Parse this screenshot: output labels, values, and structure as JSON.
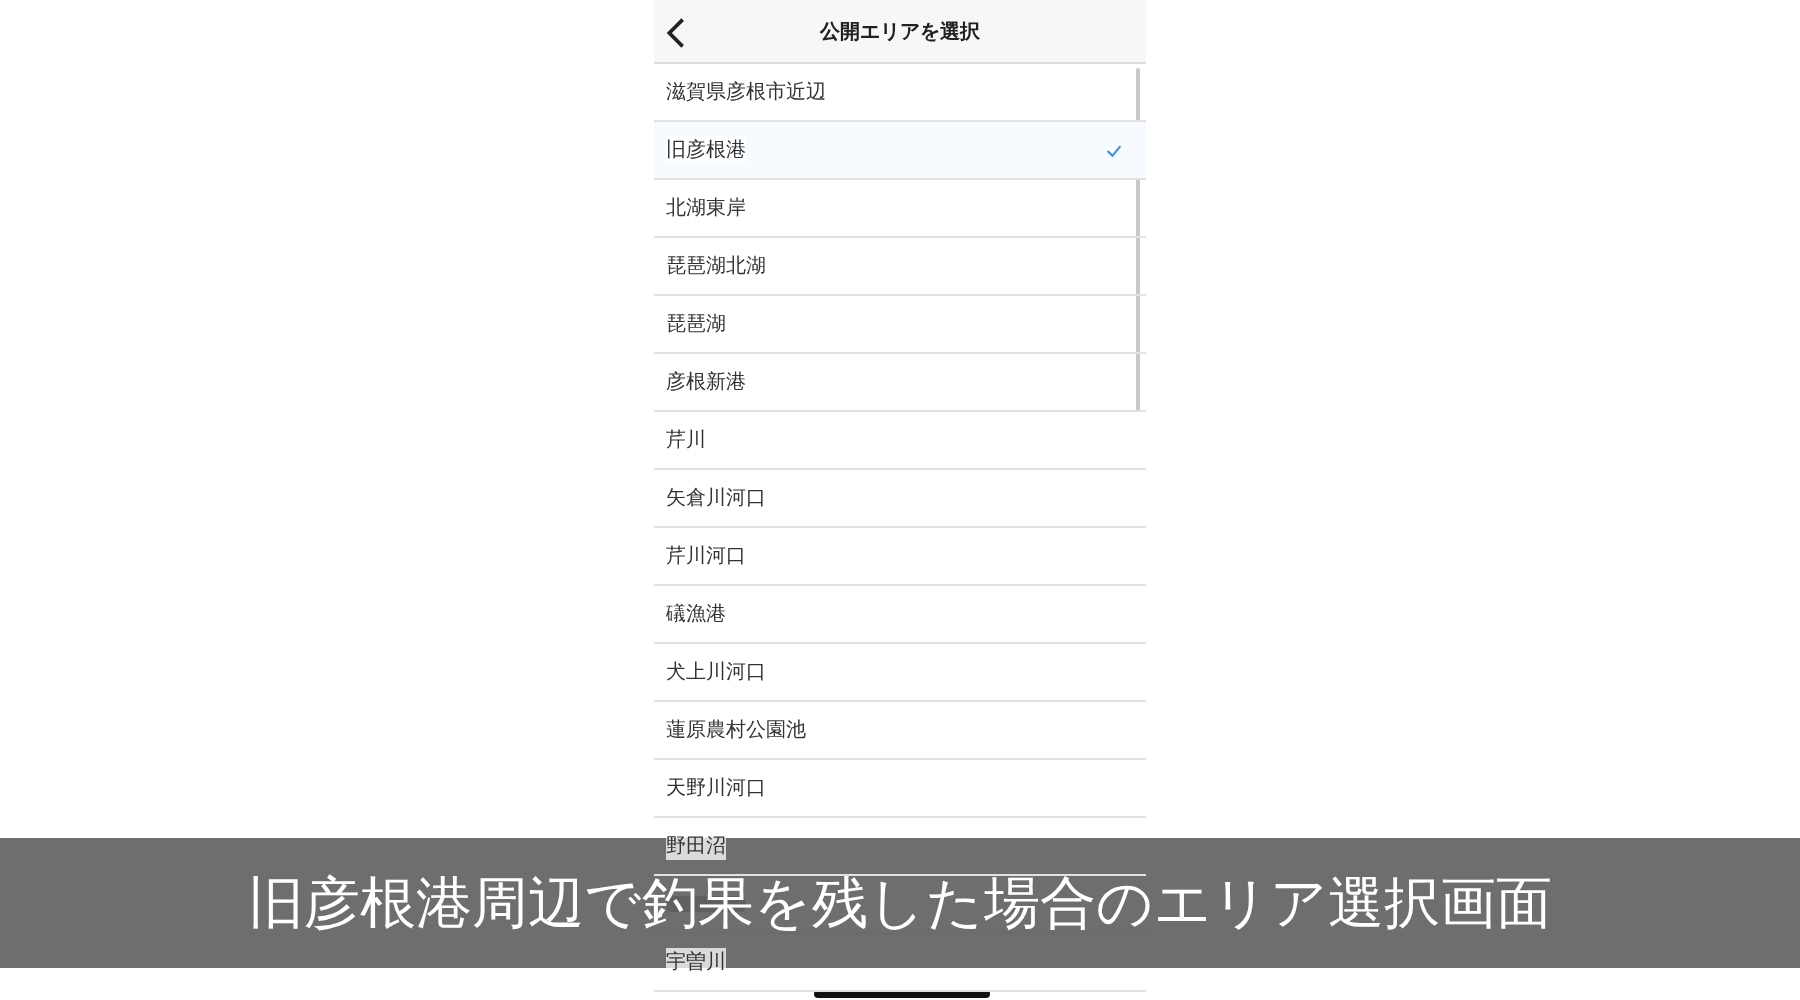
{
  "header": {
    "title": "公開エリアを選択"
  },
  "areas": [
    {
      "label": "滋賀県彦根市近辺",
      "selected": false
    },
    {
      "label": "旧彦根港",
      "selected": true
    },
    {
      "label": "北湖東岸",
      "selected": false
    },
    {
      "label": "琵琶湖北湖",
      "selected": false
    },
    {
      "label": "琵琶湖",
      "selected": false
    },
    {
      "label": "彦根新港",
      "selected": false
    },
    {
      "label": "芹川",
      "selected": false
    },
    {
      "label": "矢倉川河口",
      "selected": false
    },
    {
      "label": "芹川河口",
      "selected": false
    },
    {
      "label": "礒漁港",
      "selected": false
    },
    {
      "label": "犬上川河口",
      "selected": false
    },
    {
      "label": "蓮原農村公園池",
      "selected": false
    },
    {
      "label": "天野川河口",
      "selected": false
    },
    {
      "label": "野田沼",
      "selected": false
    },
    {
      "kind": "covered"
    },
    {
      "label": "宇曽川",
      "selected": false
    }
  ],
  "caption": "旧彦根港周辺で釣果を残した場合のエリア選択画面"
}
